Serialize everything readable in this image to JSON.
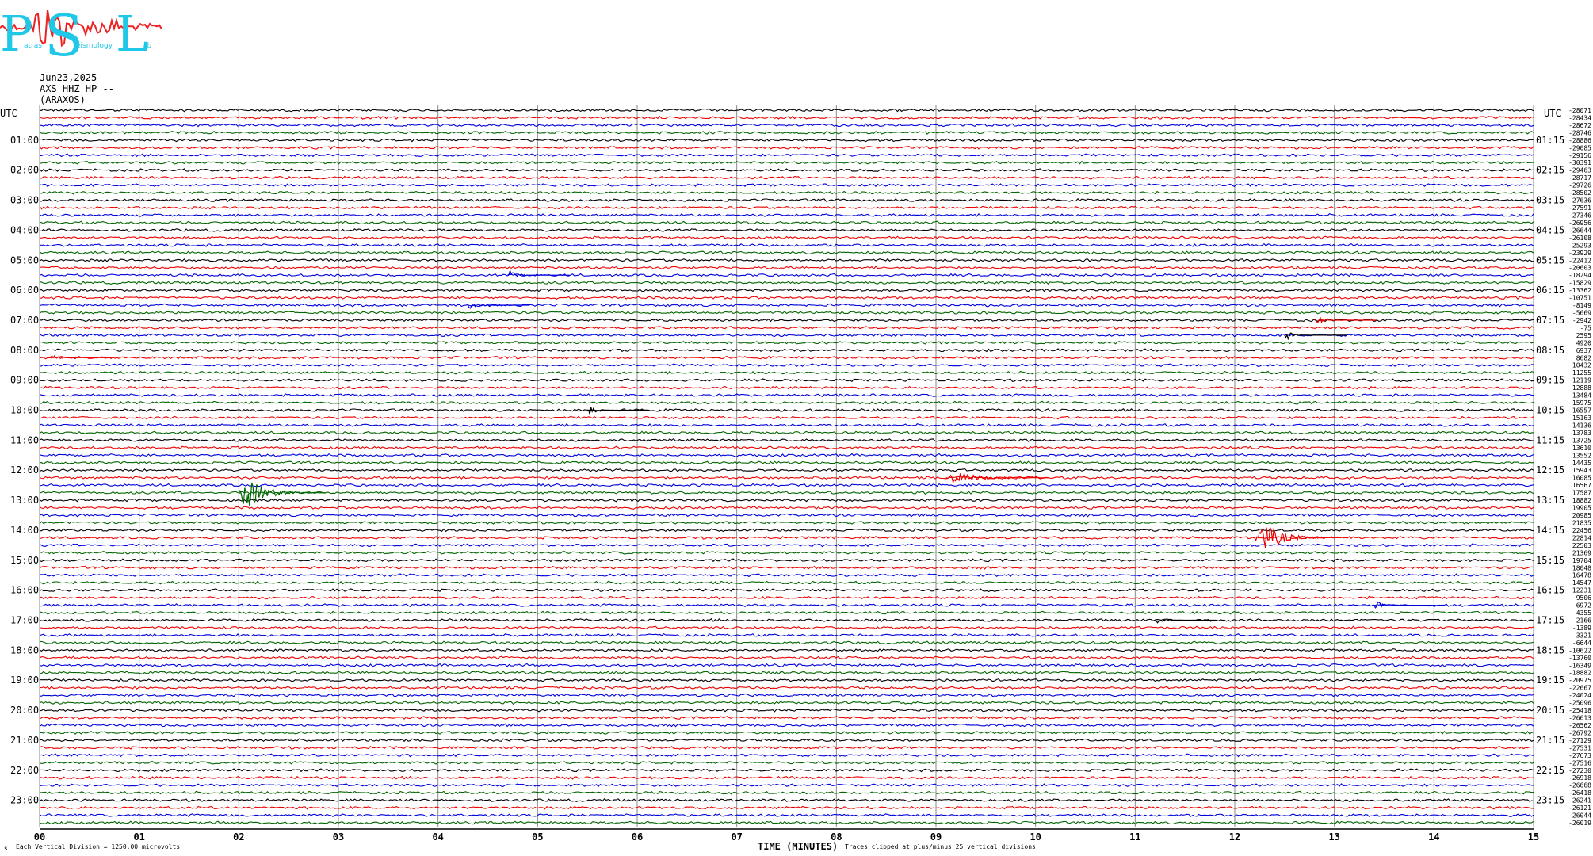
{
  "logo": {
    "letters": [
      "P",
      "S",
      "L"
    ],
    "tagline": [
      "atras",
      "eismology",
      "ab"
    ],
    "colors": {
      "letters": "#1ec8e6",
      "wave": "#ee2222"
    }
  },
  "header": {
    "date": "Jun23,2025",
    "station": "AXS HHZ HP --",
    "name": "(ARAXOS)"
  },
  "footer": {
    "division": "Each Vertical Division = 1250.00 microvolts",
    "xlabel": "TIME (MINUTES)",
    "clip_note": "Traces clipped at plus/minus 25 vertical divisions"
  },
  "chart_data": {
    "type": "line",
    "title": "",
    "xlabel": "TIME (MINUTES)",
    "x_ticks": [
      "00",
      "01",
      "02",
      "03",
      "04",
      "05",
      "06",
      "07",
      "08",
      "09",
      "10",
      "11",
      "12",
      "13",
      "14",
      "15"
    ],
    "xlim": [
      0,
      15
    ],
    "grid": true,
    "utc_label": "UTC",
    "left_labels": [
      "01:00",
      "02:00",
      "03:00",
      "04:00",
      "05:00",
      "06:00",
      "07:00",
      "08:00",
      "09:00",
      "10:00",
      "11:00",
      "12:00",
      "13:00",
      "14:00",
      "15:00",
      "16:00",
      "17:00",
      "18:00",
      "19:00",
      "20:00",
      "21:00",
      "22:00",
      "23:00"
    ],
    "right_labels": [
      "01:15",
      "02:15",
      "03:15",
      "04:15",
      "05:15",
      "06:15",
      "07:15",
      "08:15",
      "09:15",
      "10:15",
      "11:15",
      "12:15",
      "13:15",
      "14:15",
      "15:15",
      "16:15",
      "17:15",
      "18:15",
      "19:15",
      "20:15",
      "21:15",
      "22:15",
      "23:15"
    ],
    "trace_colors": [
      "#000000",
      "#ee0000",
      "#0000dd",
      "#006600"
    ],
    "trace_count": 96,
    "offsets": [
      -28071,
      -28434,
      -28672,
      -28746,
      -28886,
      -29085,
      -29156,
      -30391,
      -29463,
      -28717,
      -29726,
      -28502,
      -27636,
      -27591,
      -27346,
      -26956,
      -26644,
      -26108,
      -25293,
      -23929,
      -22412,
      -20603,
      -18294,
      -15829,
      -13362,
      -10751,
      -8149,
      -5669,
      -2942,
      -75,
      2595,
      4920,
      6937,
      8682,
      10432,
      11255,
      12119,
      12888,
      13484,
      15975,
      16557,
      15163,
      14136,
      13783,
      13725,
      13610,
      13552,
      14435,
      15943,
      16085,
      16567,
      17587,
      18882,
      19905,
      20985,
      21835,
      22456,
      22814,
      22503,
      21369,
      19704,
      18048,
      16478,
      14547,
      12231,
      9506,
      6972,
      4355,
      2166,
      -1389,
      -3321,
      -6644,
      -10622,
      -13760,
      -16349,
      -18882,
      -20975,
      -22667,
      -24024,
      -25096,
      -25418,
      -26613,
      -26562,
      -26792,
      -27129,
      -27531,
      -27673,
      -27516,
      -27230,
      -26918,
      -26668,
      -26418,
      -26241,
      -26121,
      -26044,
      -26019
    ],
    "events": [
      {
        "trace": 51,
        "minute": 2.0,
        "amplitude": "large",
        "color": "#006600"
      },
      {
        "trace": 49,
        "minute": 9.1,
        "amplitude": "medium",
        "color": "#ee0000"
      },
      {
        "trace": 57,
        "minute": 12.2,
        "amplitude": "large",
        "color": "#ee0000"
      },
      {
        "trace": 66,
        "minute": 13.4,
        "amplitude": "small",
        "color": "#0000dd"
      },
      {
        "trace": 68,
        "minute": 11.2,
        "amplitude": "small",
        "color": "#000000"
      },
      {
        "trace": 40,
        "minute": 5.5,
        "amplitude": "small",
        "color": "#000000"
      },
      {
        "trace": 33,
        "minute": 0.1,
        "amplitude": "small",
        "color": "#ee0000"
      },
      {
        "trace": 22,
        "minute": 4.7,
        "amplitude": "small",
        "color": "#0000dd"
      },
      {
        "trace": 26,
        "minute": 4.3,
        "amplitude": "small",
        "color": "#0000dd"
      },
      {
        "trace": 28,
        "minute": 12.8,
        "amplitude": "small",
        "color": "#ee0000"
      },
      {
        "trace": 30,
        "minute": 12.5,
        "amplitude": "small",
        "color": "#000000"
      }
    ]
  }
}
